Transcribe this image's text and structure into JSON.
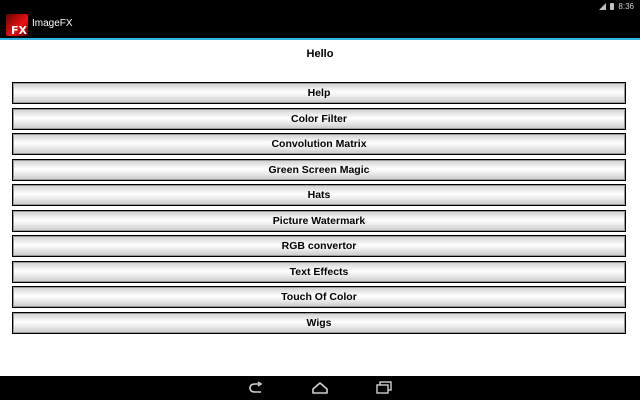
{
  "status_bar": {
    "time": "8:36"
  },
  "app": {
    "title": "ImageFX",
    "icon_text": "FX"
  },
  "greeting": "Hello",
  "menu": [
    {
      "label": "Help"
    },
    {
      "label": "Color Filter"
    },
    {
      "label": "Convolution Matrix"
    },
    {
      "label": "Green Screen Magic"
    },
    {
      "label": "Hats"
    },
    {
      "label": "Picture Watermark"
    },
    {
      "label": "RGB convertor"
    },
    {
      "label": "Text Effects"
    },
    {
      "label": "Touch Of Color"
    },
    {
      "label": "Wigs"
    }
  ],
  "nav": {
    "icons": [
      "back-icon",
      "home-icon",
      "recent-apps-icon"
    ]
  },
  "colors": {
    "accent": "#33b5e5",
    "bar_background": "#000000"
  }
}
